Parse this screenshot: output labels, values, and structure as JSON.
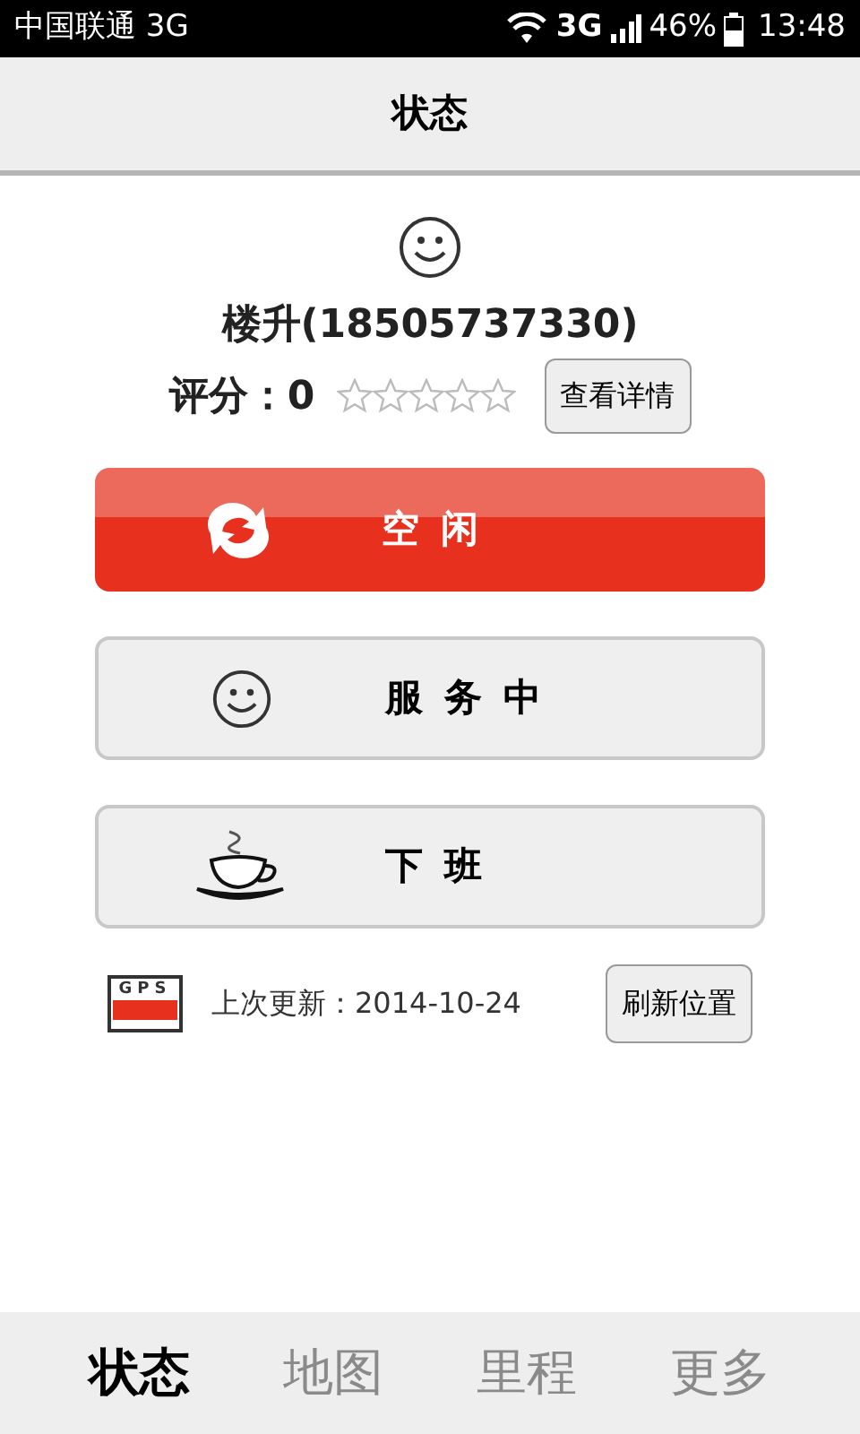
{
  "status_bar": {
    "carrier": "中国联通 3G",
    "network": "3G",
    "battery": "46%",
    "time": "13:48"
  },
  "title": "状态",
  "profile": {
    "name": "楼升(18505737330)",
    "rating_label": "评分：0",
    "stars": 0,
    "details_button": "查看详情"
  },
  "status_options": [
    {
      "label": "空闲",
      "kind": "refresh",
      "selected": true
    },
    {
      "label": "服务中",
      "kind": "smile",
      "selected": false
    },
    {
      "label": "下班",
      "kind": "coffee",
      "selected": false
    }
  ],
  "gps": {
    "badge": "GPS",
    "last_update": "上次更新：2014-10-24",
    "refresh_button": "刷新位置"
  },
  "tabs": [
    {
      "label": "状态",
      "selected": true
    },
    {
      "label": "地图",
      "selected": false
    },
    {
      "label": "里程",
      "selected": false
    },
    {
      "label": "更多",
      "selected": false
    }
  ]
}
